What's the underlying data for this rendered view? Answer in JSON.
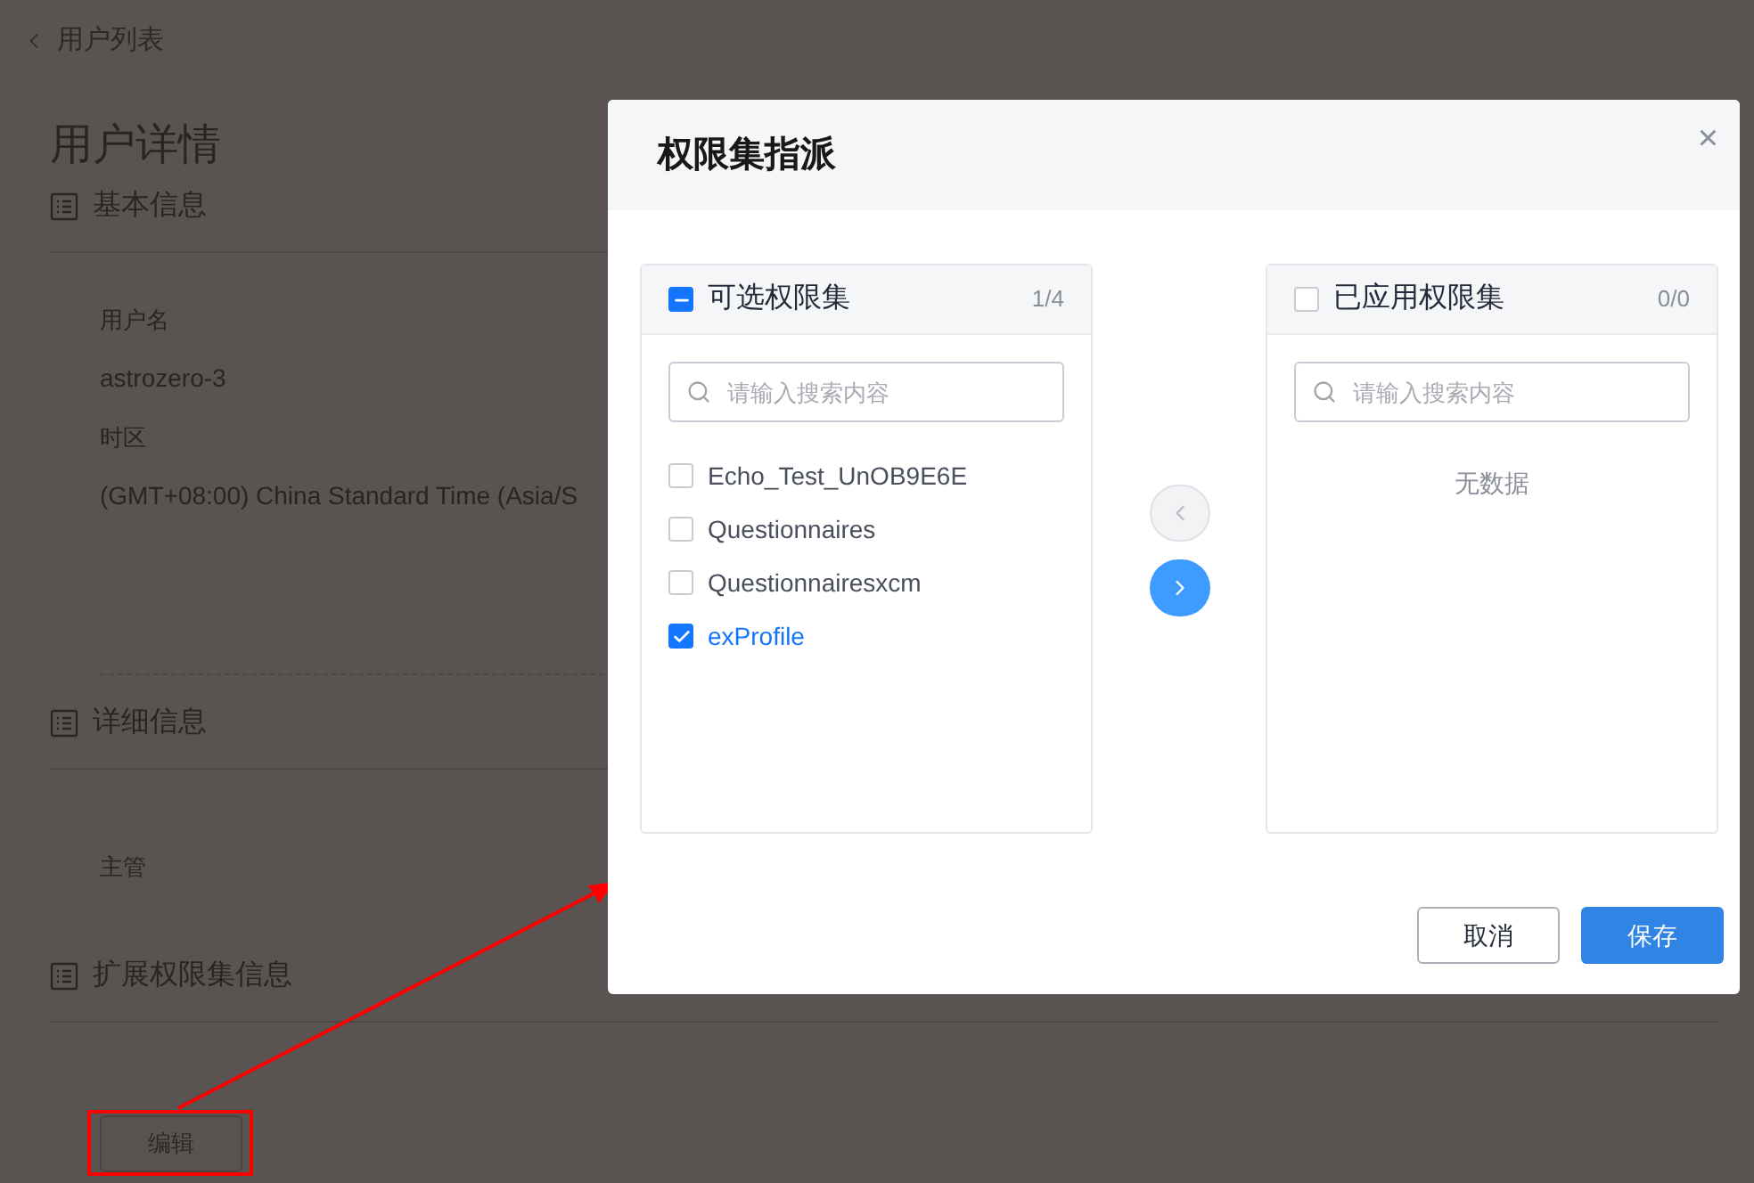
{
  "back_link": {
    "label": "用户列表"
  },
  "page_title": "用户详情",
  "sections": [
    {
      "title": "基本信息",
      "fields": [
        {
          "label": "用户名",
          "value": "astrozero-3"
        },
        {
          "label": "时区",
          "value": "(GMT+08:00) China Standard Time (Asia/S"
        }
      ]
    },
    {
      "title": "详细信息",
      "fields": [
        {
          "label": "主管"
        }
      ]
    },
    {
      "title": "扩展权限集信息"
    }
  ],
  "edit_button": {
    "label": "编辑"
  },
  "dialog": {
    "title": "权限集指派",
    "close": "×",
    "source_panel": {
      "title": "可选权限集",
      "count": "1/4",
      "indeterminate": true,
      "search": {
        "placeholder": "请输入搜索内容"
      },
      "items": [
        {
          "label": "Echo_Test_UnOB9E6E",
          "checked": false
        },
        {
          "label": "Questionnaires",
          "checked": false
        },
        {
          "label": "Questionnairesxcm",
          "checked": false
        },
        {
          "label": "exProfile",
          "checked": true
        }
      ]
    },
    "transfer_buttons": [
      {
        "kind": "left",
        "disabled": true
      },
      {
        "kind": "right",
        "disabled": false
      }
    ],
    "target_panel": {
      "title": "已应用权限集",
      "count": "0/0",
      "checked": false,
      "search": {
        "placeholder": "请输入搜索内容"
      },
      "empty_text": "无数据"
    },
    "buttons": [
      {
        "label": "取消",
        "kind": "secondary"
      },
      {
        "label": "保存",
        "kind": "primary"
      }
    ]
  }
}
